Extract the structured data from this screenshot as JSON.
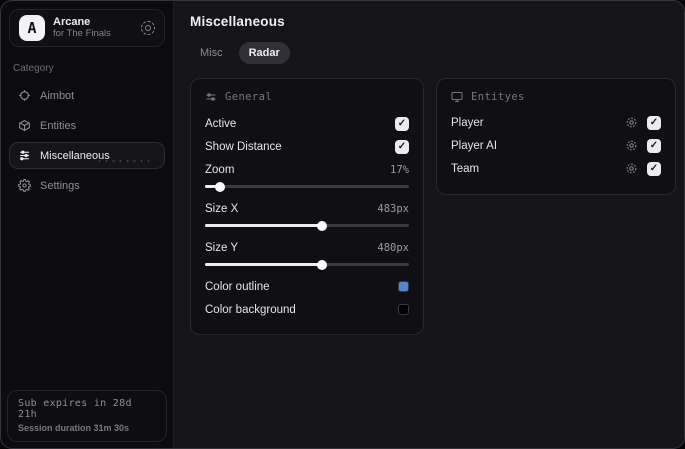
{
  "accent_color": "#c01b3c",
  "sidebar": {
    "logo": {
      "initial": "A",
      "title": "Arcane",
      "subtitle": "for The Finals"
    },
    "category_label": "Category",
    "items": [
      {
        "label": "Aimbot",
        "icon": "crosshair-icon",
        "active": false
      },
      {
        "label": "Entities",
        "icon": "cube-icon",
        "active": false
      },
      {
        "label": "Miscellaneous",
        "icon": "sliders-icon",
        "active": true
      },
      {
        "label": "Settings",
        "icon": "gear-icon",
        "active": false
      }
    ],
    "footer": {
      "sub_expires": "Sub expires in 28d 21h",
      "session_duration": "Session duration 31m 30s"
    }
  },
  "main": {
    "title": "Miscellaneous",
    "tabs": [
      {
        "label": "Misc",
        "active": false
      },
      {
        "label": "Radar",
        "active": true
      }
    ]
  },
  "general_panel": {
    "title": "General",
    "active": {
      "label": "Active",
      "checked": true
    },
    "show_distance": {
      "label": "Show Distance",
      "checked": true
    },
    "zoom": {
      "label": "Zoom",
      "value": "17%",
      "fill": "8%"
    },
    "size_x": {
      "label": "Size X",
      "value": "483px",
      "fill": "58%"
    },
    "size_y": {
      "label": "Size Y",
      "value": "480px",
      "fill": "58%"
    },
    "color_outline": {
      "label": "Color outline",
      "color": "#5187cc"
    },
    "color_background": {
      "label": "Color background",
      "color": "#000000"
    }
  },
  "entities_panel": {
    "title": "Entityes",
    "rows": [
      {
        "label": "Player",
        "checked": true
      },
      {
        "label": "Player AI",
        "checked": true
      },
      {
        "label": "Team",
        "checked": true
      }
    ]
  }
}
